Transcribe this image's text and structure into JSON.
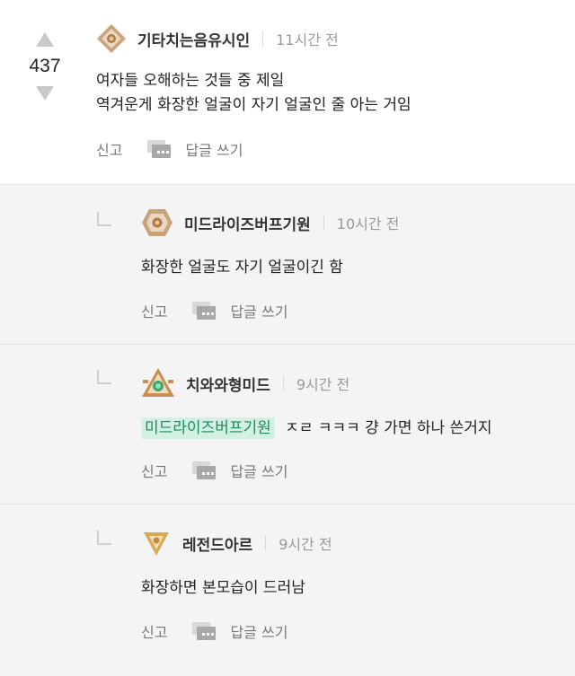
{
  "post": {
    "vote_count": "437",
    "author": "기타치는음유시인",
    "time": "11시간 전",
    "lines": [
      "여자들 오해하는 것들 중 제일",
      "역겨운게 화장한 얼굴이 자기 얼굴인 줄 아는 거임"
    ],
    "report_label": "신고",
    "reply_label": "답글 쓰기"
  },
  "comments": [
    {
      "author": "미드라이즈버프기원",
      "time": "10시간 전",
      "text": "화장한 얼굴도 자기 얼굴이긴 함",
      "report_label": "신고",
      "reply_label": "답글 쓰기"
    },
    {
      "author": "치와와형미드",
      "time": "9시간 전",
      "mention": "미드라이즈버프기원",
      "text": "ㅈㄹ ㅋㅋㅋ 걍 가면 하나 쓴거지",
      "report_label": "신고",
      "reply_label": "답글 쓰기"
    },
    {
      "author": "레전드아르",
      "time": "9시간 전",
      "text": "화장하면 본모습이 드러남",
      "report_label": "신고",
      "reply_label": "답글 쓰기"
    }
  ],
  "colors": {
    "mention_bg": "#d3f0e4",
    "mention_text": "#1f8a5e",
    "comment_bg": "#f4f4f4"
  },
  "icons": [
    "upvote-arrow-icon",
    "downvote-arrow-icon",
    "bronze-rank-badge-icon",
    "emerald-rank-badge-icon",
    "gold-rank-badge-icon",
    "reply-speech-icon"
  ]
}
